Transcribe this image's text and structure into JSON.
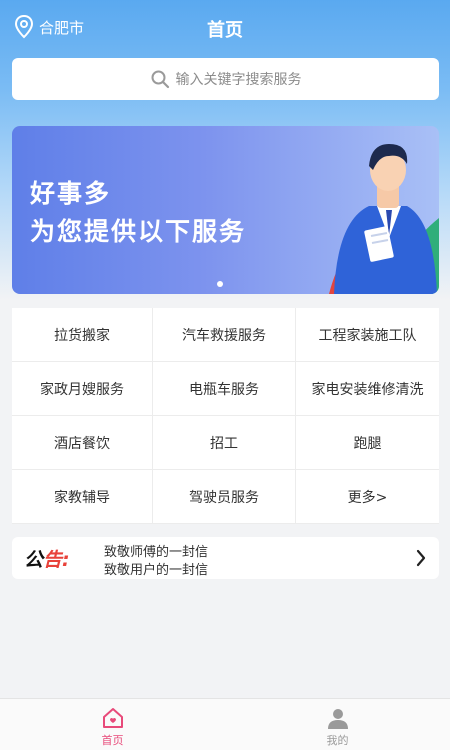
{
  "header": {
    "location": "合肥市",
    "title": "首页"
  },
  "search": {
    "placeholder": "输入关键字搜索服务"
  },
  "banner": {
    "line1": "好事多",
    "line2": "为您提供以下服务"
  },
  "services": [
    {
      "label": "拉货搬家"
    },
    {
      "label": "汽车救援服务"
    },
    {
      "label": "工程家装施工队"
    },
    {
      "label": "家政月嫂服务"
    },
    {
      "label": "电瓶车服务"
    },
    {
      "label": "家电安装维修清洗"
    },
    {
      "label": "酒店餐饮"
    },
    {
      "label": "招工"
    },
    {
      "label": "跑腿"
    },
    {
      "label": "家教辅导"
    },
    {
      "label": "驾驶员服务"
    },
    {
      "label": "更多>"
    }
  ],
  "notice": {
    "tag_part1": "公",
    "tag_part2": "告:",
    "items": [
      "致敬师傅的一封信",
      "致敬用户的一封信"
    ]
  },
  "tabbar": {
    "tabs": [
      {
        "label": "首页",
        "icon": "home-icon",
        "active": true
      },
      {
        "label": "我的",
        "icon": "user-icon",
        "active": false
      }
    ]
  },
  "colors": {
    "header_gradient_top": "#5aa9f0",
    "active_tab": "#e84a7a",
    "notice_red": "#e8423a",
    "banner_blue": "#5f7fe8"
  }
}
